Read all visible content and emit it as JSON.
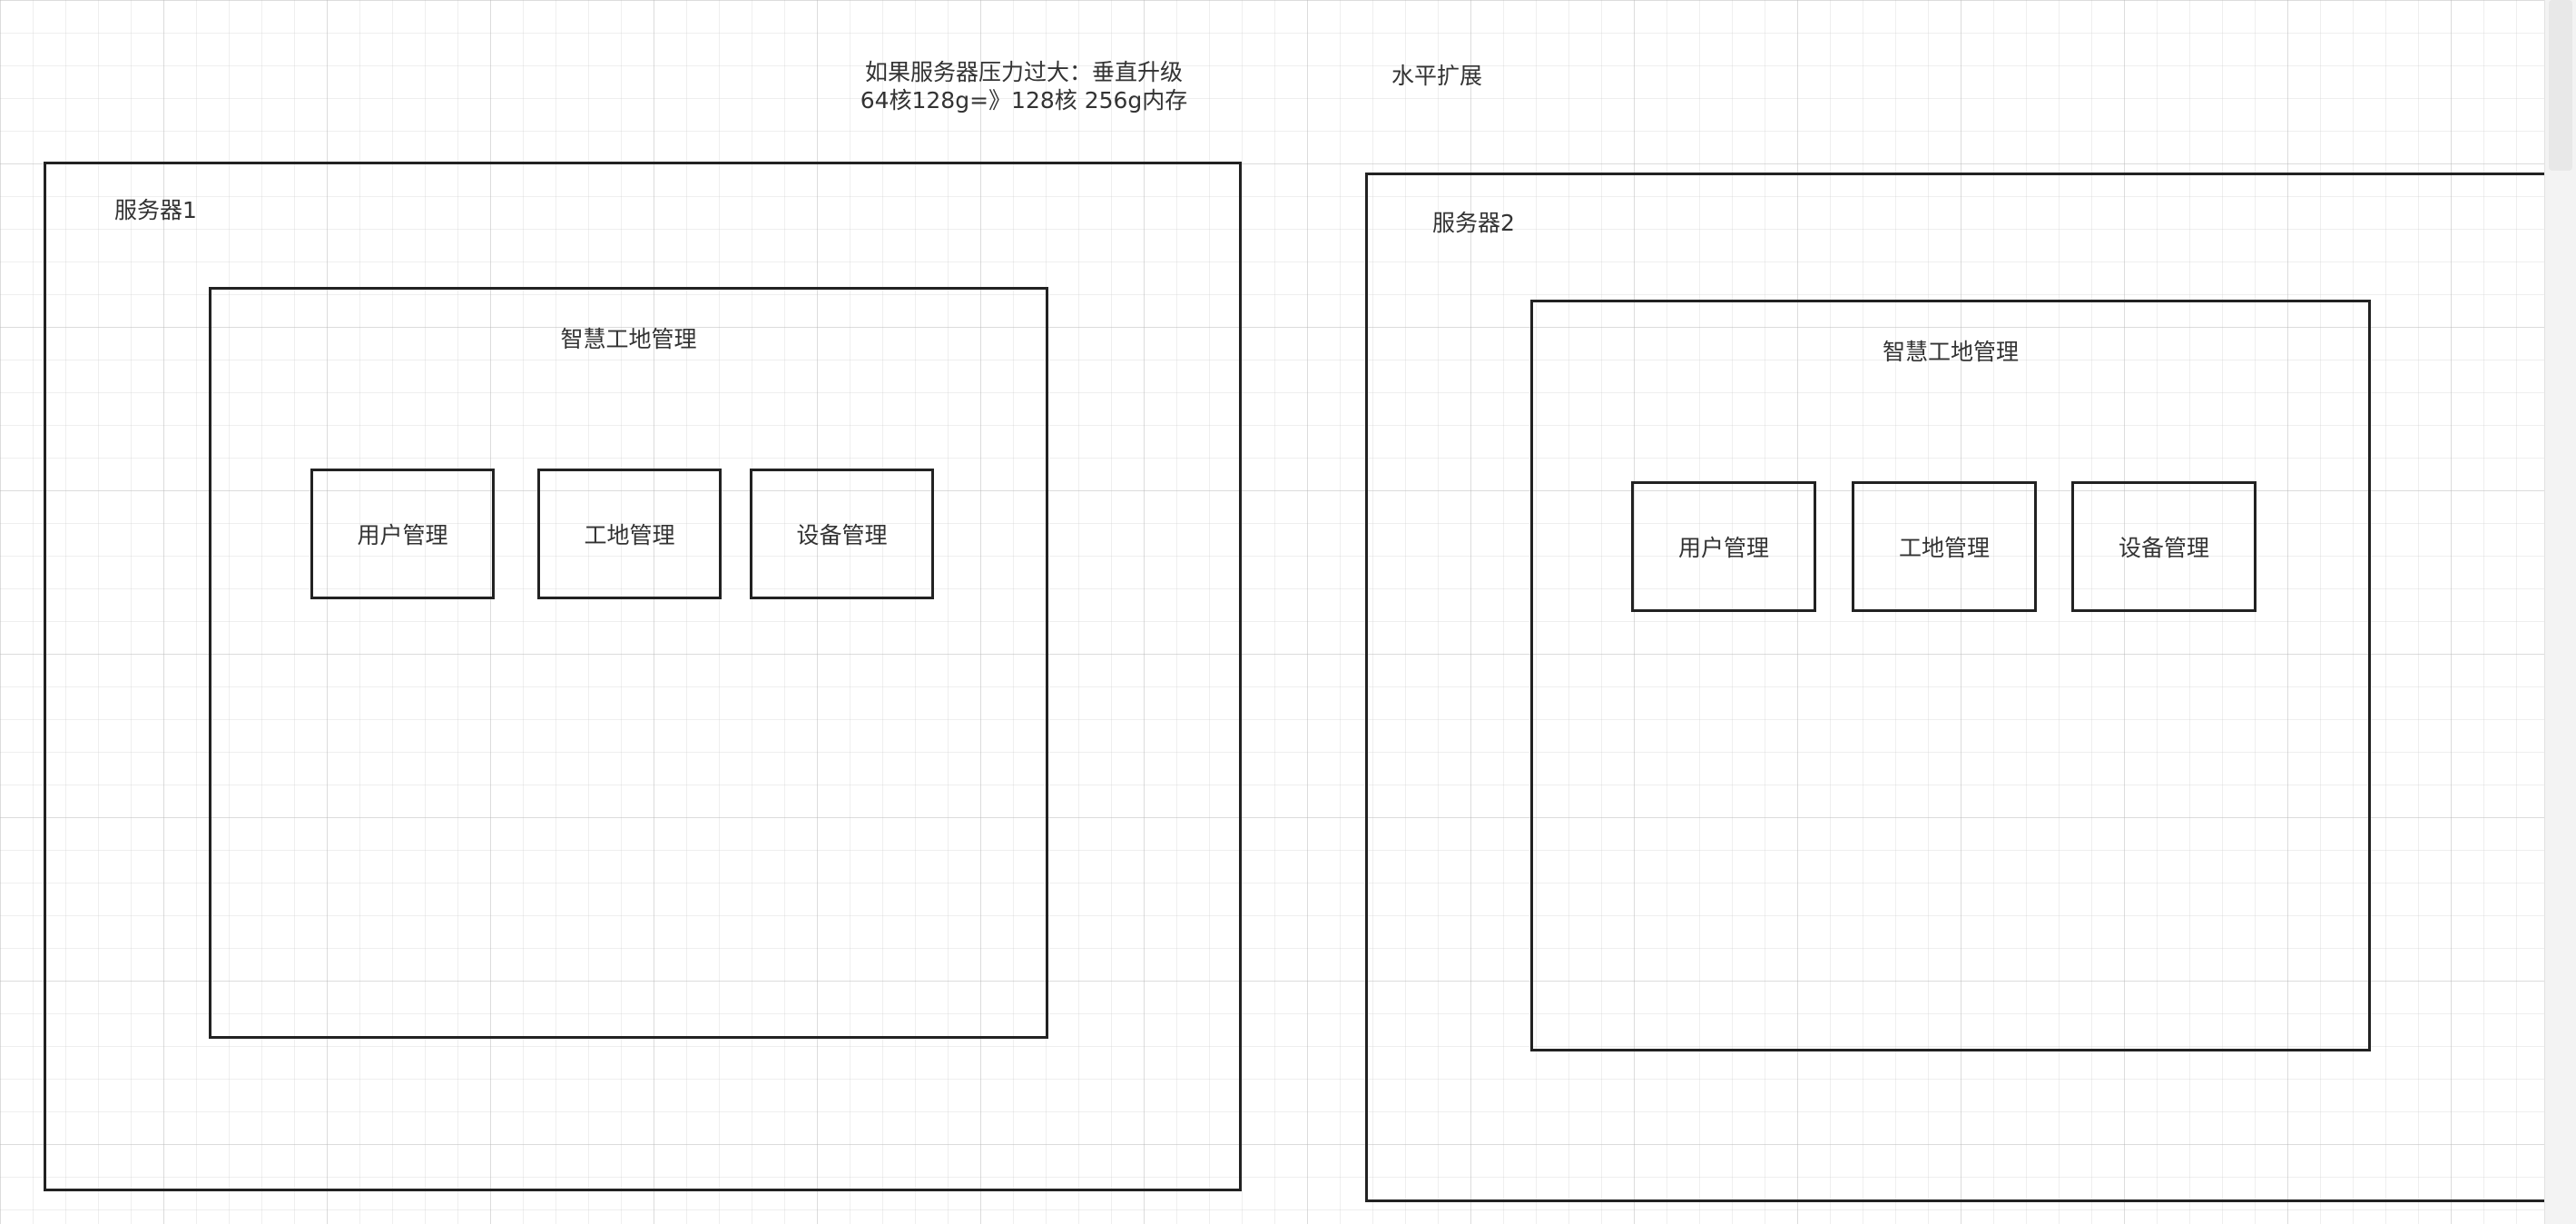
{
  "annotations": {
    "vertical_upgrade_line1": "如果服务器压力过大：垂直升级",
    "vertical_upgrade_line2": "64核128g=》128核 256g内存",
    "horizontal_scaling": "水平扩展"
  },
  "servers": [
    {
      "label": "服务器1",
      "app": {
        "title": "智慧工地管理",
        "modules": [
          "用户管理",
          "工地管理",
          "设备管理"
        ]
      }
    },
    {
      "label": "服务器2",
      "app": {
        "title": "智慧工地管理",
        "modules": [
          "用户管理",
          "工地管理",
          "设备管理"
        ]
      }
    }
  ]
}
